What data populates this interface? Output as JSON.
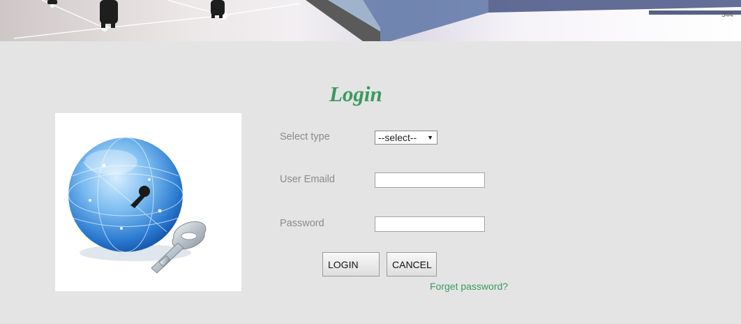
{
  "banner": {
    "stat_text": "344"
  },
  "title": "Login",
  "form": {
    "select_type_label": "Select type",
    "select_type_value": "--select--",
    "select_arrow": "▼",
    "email_label": "User Emaild",
    "email_value": "",
    "password_label": "Password",
    "password_value": ""
  },
  "buttons": {
    "login": "LOGIN",
    "cancel": "CANCEL"
  },
  "forgot_link": "Forget password?",
  "colors": {
    "accent": "#3a9a60",
    "page_bg": "#e4e4e4",
    "label": "#8b8b8b"
  }
}
